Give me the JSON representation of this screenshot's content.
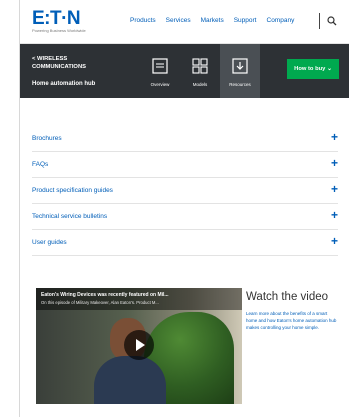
{
  "brand": {
    "logo_text": "E:T·N",
    "tagline": "Powering Business Worldwide"
  },
  "nav": {
    "items": [
      "Products",
      "Services",
      "Markets",
      "Support",
      "Company"
    ]
  },
  "section_nav": {
    "back_label": "< WIRELESS COMMUNICATIONS",
    "page_name": "Home automation hub",
    "tabs": [
      {
        "label": "Overview",
        "icon": "monitor-icon",
        "active": false
      },
      {
        "label": "Models",
        "icon": "grid-icon",
        "active": false
      },
      {
        "label": "Resources",
        "icon": "download-icon",
        "active": true
      }
    ],
    "cta_label": "How to buy  ⌄"
  },
  "resources": [
    {
      "label": "Brochures"
    },
    {
      "label": "FAQs"
    },
    {
      "label": "Product specification guides"
    },
    {
      "label": "Technical service bulletins"
    },
    {
      "label": "User guides"
    }
  ],
  "video": {
    "title": "Eaton's Wiring Devices was recently featured on Mil...",
    "subtitle": "On this episode of Military Makeover, Alan Eaton's. Product M...",
    "heading": "Watch the video",
    "description": "Learn more about the benefits of a smart home and how Eaton's home automation hub makes controlling your home simple."
  },
  "colors": {
    "brand_blue": "#005eb8",
    "nav_dark": "#2d3135",
    "cta_green": "#00a94f"
  }
}
